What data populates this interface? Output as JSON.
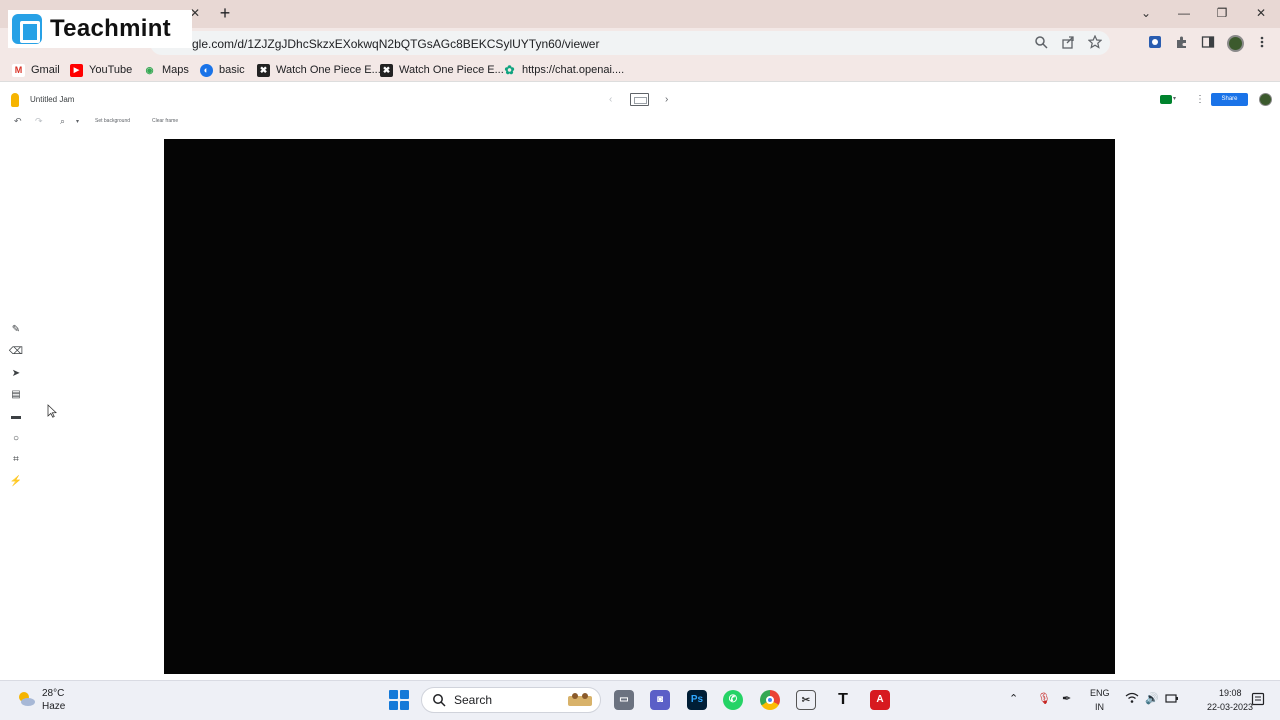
{
  "overlay": {
    "brand": "Teachmint"
  },
  "browser": {
    "tab_close_glyph": "✕",
    "new_tab_glyph": "+",
    "url": "gle.com/d/1ZJZgJDhcSkzxEXokwqN2bQTGsAGc8BEKCSylUYTyn60/viewer",
    "window_controls": [
      "⌄",
      "—",
      "❐",
      "✕"
    ],
    "bookmarks": [
      {
        "label": "Gmail",
        "icon": "gmail-icon",
        "color": "#d93025",
        "glyph": "M"
      },
      {
        "label": "YouTube",
        "icon": "youtube-icon",
        "color": "#ff0000",
        "glyph": "▶"
      },
      {
        "label": "Maps",
        "icon": "maps-icon",
        "color": "#34a853",
        "glyph": "◉"
      },
      {
        "label": "basic",
        "icon": "basic-icon",
        "color": "#1a73e8",
        "glyph": "◐"
      },
      {
        "label": "Watch One Piece E...",
        "icon": "onepiece-icon",
        "color": "#222222",
        "glyph": "✖"
      },
      {
        "label": "Watch One Piece E...",
        "icon": "onepiece-icon",
        "color": "#222222",
        "glyph": "✖"
      },
      {
        "label": "https://chat.openai....",
        "icon": "openai-icon",
        "color": "#10a37f",
        "glyph": "✿"
      }
    ]
  },
  "jamboard": {
    "title": "Untitled Jam",
    "prev_glyph": "‹",
    "next_glyph": "›",
    "share_label": "Share",
    "toolbar": {
      "undo_glyph": "↶",
      "redo_glyph": "↷",
      "zoom_glyph": "⌕",
      "set_background": "Set background",
      "clear_frame": "Clear frame"
    },
    "tools": [
      {
        "name": "pen-tool",
        "glyph": "✎"
      },
      {
        "name": "eraser-tool",
        "glyph": "⌫"
      },
      {
        "name": "select-tool",
        "glyph": "➤"
      },
      {
        "name": "sticky-note-tool",
        "glyph": "▤"
      },
      {
        "name": "add-image-tool",
        "glyph": "▬"
      },
      {
        "name": "circle-tool",
        "glyph": "○"
      },
      {
        "name": "text-box-tool",
        "glyph": "⌗"
      },
      {
        "name": "laser-tool",
        "glyph": "⚡"
      }
    ],
    "canvas_color": "#050505"
  },
  "taskbar": {
    "temperature": "28°C",
    "weather": "Haze",
    "search_label": "Search",
    "language_line1": "ENG",
    "language_line2": "IN",
    "time": "19:08",
    "date": "22-03-2023"
  }
}
